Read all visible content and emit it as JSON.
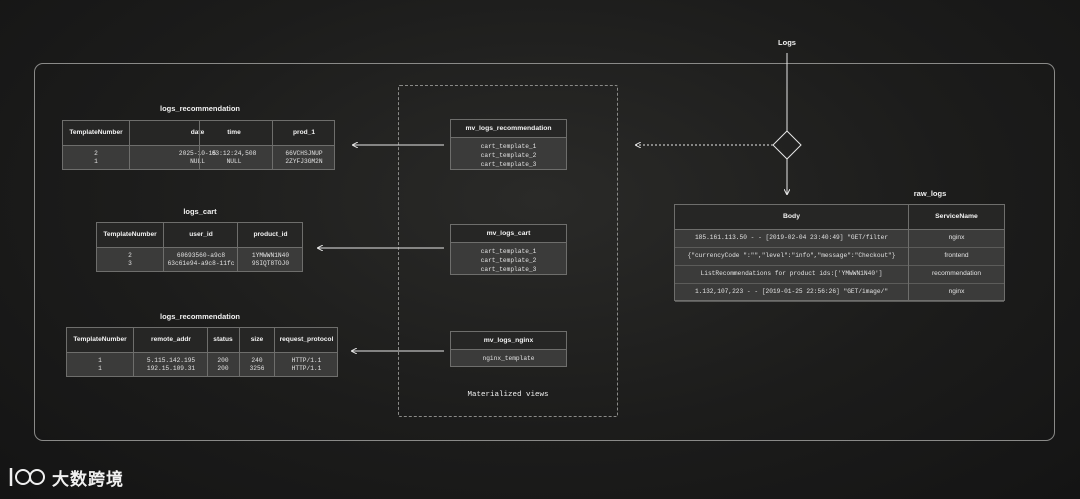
{
  "logs_label": "Logs",
  "materialized_label": "Materialized views",
  "brand": "大数跨境",
  "tables": [
    {
      "title": "logs_recommendation",
      "headers": [
        "TemplateNumber",
        "date",
        "time",
        "prod_1"
      ],
      "rows": [
        [
          "2",
          "2025-10-15",
          "03:12:24,508",
          "66VCHSJNUP"
        ],
        [
          "1",
          "NULL",
          "NULL",
          "2ZYFJ3GM2N"
        ]
      ]
    },
    {
      "title": "logs_cart",
      "headers": [
        "TemplateNumber",
        "user_id",
        "product_id"
      ],
      "rows": [
        [
          "2",
          "60693560-a9c8",
          "1YMWWN1N40"
        ],
        [
          "3",
          "63c61e94-a9c8-11fc",
          "9SIQT8TOJ0"
        ]
      ]
    },
    {
      "title": "logs_recommendation",
      "headers": [
        "TemplateNumber",
        "remote_addr",
        "status",
        "size",
        "request_protocol"
      ],
      "rows": [
        [
          "1",
          "5.115.142.195",
          "200",
          "240",
          "HTTP/1.1"
        ],
        [
          "1",
          "192.15.109.31",
          "200",
          "3256",
          "HTTP/1.1"
        ]
      ]
    }
  ],
  "views": [
    {
      "name": "mv_logs_recommendation",
      "items": [
        "cart_template_1",
        "cart_template_2",
        "cart_template_3"
      ]
    },
    {
      "name": "mv_logs_cart",
      "items": [
        "cart_template_1",
        "cart_template_2",
        "cart_template_3"
      ]
    },
    {
      "name": "mv_logs_nginx",
      "items": [
        "nginx_template"
      ]
    }
  ],
  "raw_logs": {
    "title": "raw_logs",
    "headers": [
      "Body",
      "ServiceName"
    ],
    "rows": [
      [
        "185.161.113.50 - - [2019-02-04 23:40:49] \"GET/filter",
        "nginx"
      ],
      [
        "{\"currencyCode \":\"\",\"level\":\"info\",\"message\":\"Checkout\"}",
        "frontend"
      ],
      [
        "ListRecommendations for product ids:['YMWWN1N40']",
        "recommendation"
      ],
      [
        "1.132,107,223 - - [2019-01-25 22:56:26] \"GET/image/\"",
        "nginx"
      ]
    ]
  },
  "colors": {
    "background": "#1c1c1b",
    "table": "#3b3b3a",
    "header": "#262625",
    "line": "#e6e6e6"
  }
}
